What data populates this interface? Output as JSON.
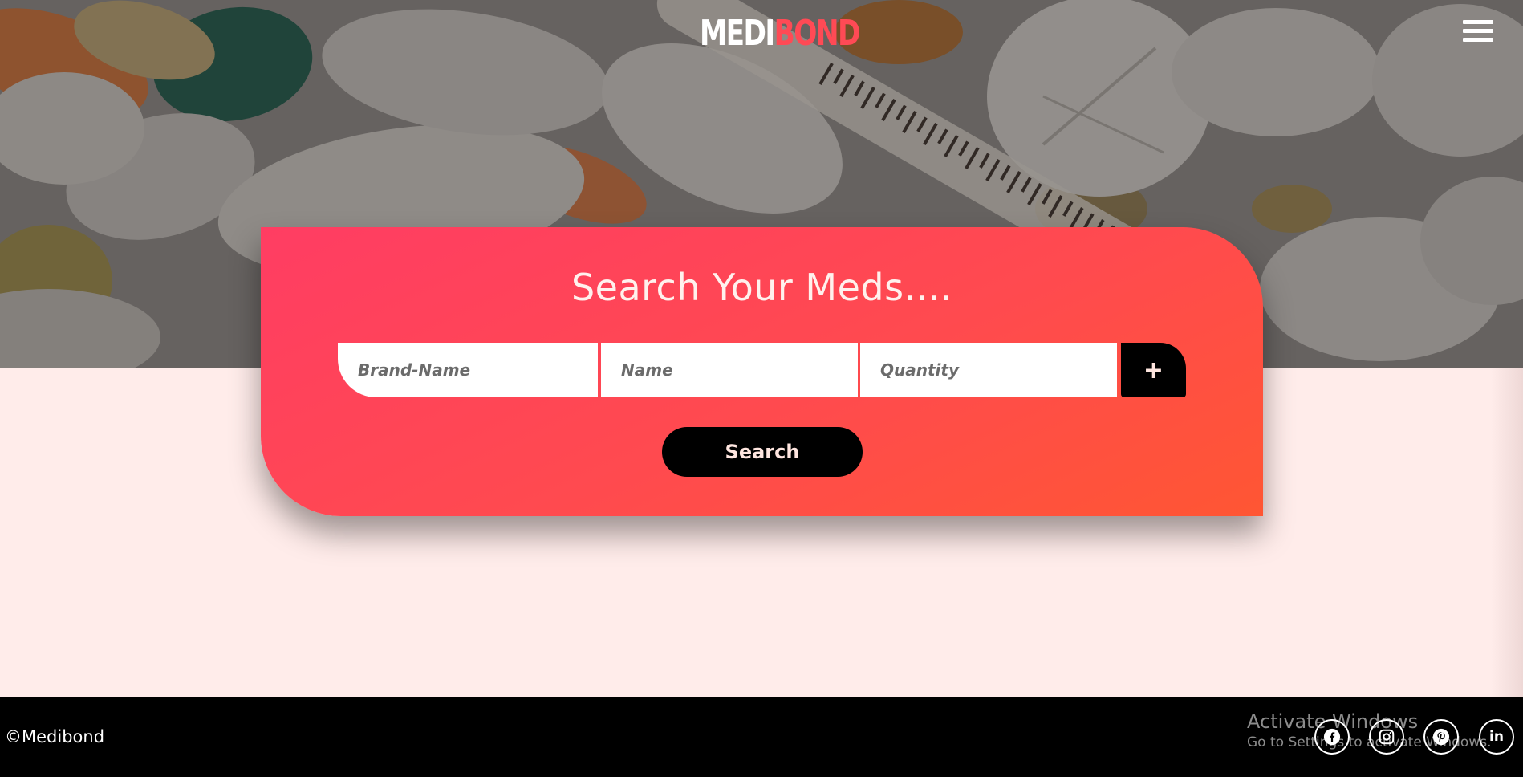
{
  "header": {
    "logo_part1": "MEDI",
    "logo_part2": "BOND",
    "menu_icon": "hamburger-icon"
  },
  "search_card": {
    "title": "Search Your Meds....",
    "brand_placeholder": "Brand-Name",
    "name_placeholder": "Name",
    "quantity_placeholder": "Quantity",
    "add_label": "+",
    "search_label": "Search"
  },
  "footer": {
    "copyright": "©Medibond",
    "social": [
      "facebook-icon",
      "instagram-icon",
      "pinterest-icon",
      "linkedin-icon"
    ],
    "linkedin_text": "in"
  },
  "os_watermark": {
    "line1": "Activate Windows",
    "line2": "Go to Settings to activate Windows."
  },
  "colors": {
    "card_gradient_start": "#ff3d63",
    "card_gradient_end": "#ff5633",
    "logo_accent": "#ff4a55",
    "page_background": "#ffecea",
    "footer_background": "#000000"
  }
}
